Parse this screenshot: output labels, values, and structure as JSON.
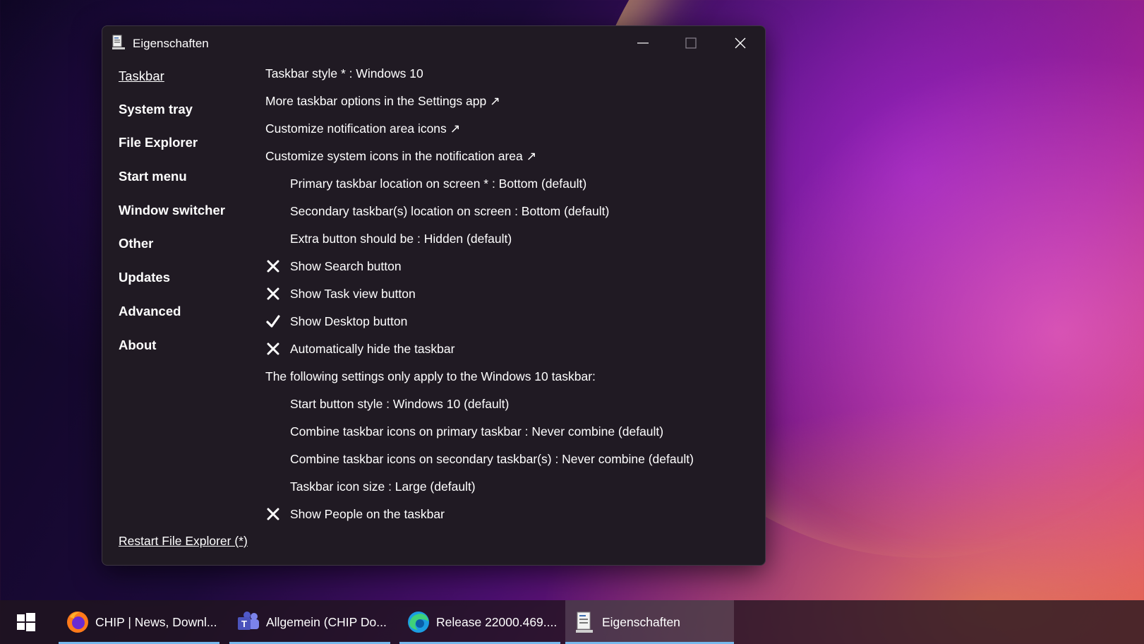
{
  "window": {
    "title": "Eigenschaften"
  },
  "sidebar": {
    "items": [
      {
        "label": "Taskbar",
        "active": true
      },
      {
        "label": "System tray"
      },
      {
        "label": "File Explorer"
      },
      {
        "label": "Start menu"
      },
      {
        "label": "Window switcher"
      },
      {
        "label": "Other"
      },
      {
        "label": "Updates"
      },
      {
        "label": "Advanced"
      },
      {
        "label": "About"
      }
    ],
    "restart_link": "Restart File Explorer (*)"
  },
  "settings": [
    {
      "text": "Taskbar style * : Windows 10"
    },
    {
      "text": "More taskbar options in the Settings app ↗"
    },
    {
      "text": "Customize notification area icons ↗"
    },
    {
      "text": "Customize system icons in the notification area ↗"
    },
    {
      "text": "Primary taskbar location on screen * : Bottom (default)"
    },
    {
      "text": "Secondary taskbar(s) location on screen : Bottom (default)"
    },
    {
      "text": "Extra button should be : Hidden (default)"
    },
    {
      "text": "Show Search button",
      "checked": false
    },
    {
      "text": "Show Task view button",
      "checked": false
    },
    {
      "text": "Show Desktop button",
      "checked": true
    },
    {
      "text": "Automatically hide the taskbar",
      "checked": false
    },
    {
      "text": "The following settings only apply to the Windows 10 taskbar:"
    },
    {
      "text": "Start button style : Windows 10 (default)"
    },
    {
      "text": "Combine taskbar icons on primary taskbar : Never combine (default)"
    },
    {
      "text": "Combine taskbar icons on secondary taskbar(s) : Never combine (default)"
    },
    {
      "text": "Taskbar icon size : Large (default)"
    },
    {
      "text": "Show People on the taskbar",
      "checked": false
    }
  ],
  "taskbar": {
    "apps": [
      {
        "label": "CHIP | News, Downl...",
        "icon": "firefox-icon"
      },
      {
        "label": "Allgemein (CHIP Do...",
        "icon": "teams-icon"
      },
      {
        "label": "Release 22000.469....",
        "icon": "edge-icon"
      },
      {
        "label": "Eigenschaften",
        "icon": "properties-app-icon",
        "active": true
      }
    ]
  },
  "colors": {
    "window_bg": "#201a23",
    "accent_underline": "#76b9ed",
    "text": "#ffffff"
  }
}
